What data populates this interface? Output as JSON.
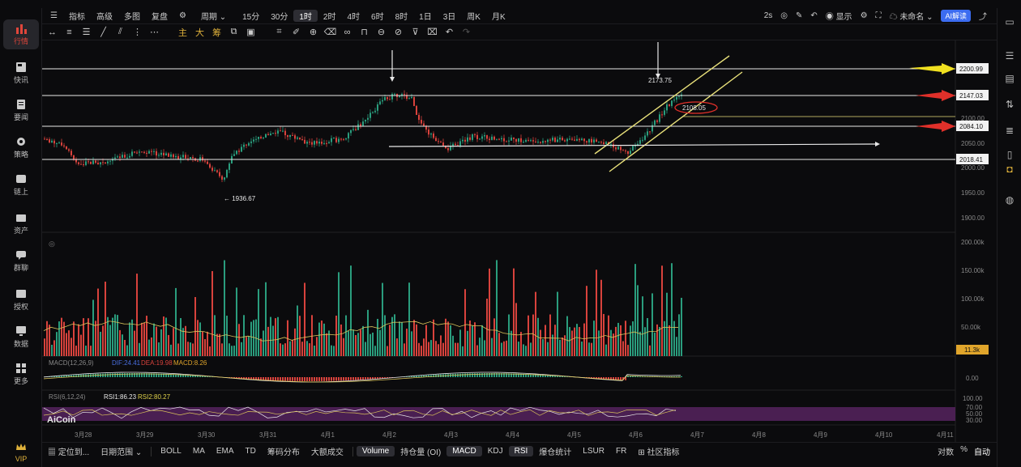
{
  "nav": {
    "items": [
      {
        "label": "行情",
        "icon": "bar-chart-icon"
      },
      {
        "label": "快讯",
        "icon": "news-icon"
      },
      {
        "label": "要闻",
        "icon": "document-icon"
      },
      {
        "label": "策略",
        "icon": "strategy-icon"
      },
      {
        "label": "链上",
        "icon": "chain-icon"
      },
      {
        "label": "资产",
        "icon": "wallet-icon"
      },
      {
        "label": "群聊",
        "icon": "chat-icon"
      },
      {
        "label": "授权",
        "icon": "key-icon"
      },
      {
        "label": "数据",
        "icon": "monitor-icon"
      },
      {
        "label": "更多",
        "icon": "grid-icon"
      },
      {
        "label": "VIP",
        "icon": "crown-icon"
      }
    ]
  },
  "toolbar": {
    "items": [
      "指标",
      "高级",
      "多图",
      "复盘"
    ],
    "period_label": "周期",
    "periods": [
      "15分",
      "30分",
      "1时",
      "2时",
      "4时",
      "6时",
      "8时",
      "1日",
      "3日",
      "周K",
      "月K"
    ],
    "active_period": "1时",
    "right": {
      "refresh": "2s",
      "display": "显示",
      "unnamed": "未命名",
      "ai": "AI解读"
    }
  },
  "drawtools": {
    "labels": [
      "主",
      "大",
      "筹"
    ]
  },
  "chart": {
    "price_labels": [
      "2200.99",
      "2147.03",
      "2084.10",
      "2018.41"
    ],
    "price_axis": [
      "2150.00",
      "2100.00",
      "2050.00",
      "2000.00",
      "1950.00",
      "1900.00"
    ],
    "annotations": {
      "high": "2173.75",
      "circle": "2108.05",
      "low": "← 1936.67"
    },
    "volume_axis": [
      "200.00k",
      "150.00k",
      "100.00k",
      "50.00k"
    ],
    "volume_current": "11.3k",
    "macd": {
      "label": "MACD(12,26,9)",
      "dif": "DIF:24.41",
      "dea": "DEA:19.98",
      "macd": "MACD:8.26",
      "axis": "0.00"
    },
    "rsi": {
      "label": "RSI(6,12,24)",
      "rsi1": "RSI1:86.23",
      "rsi2": "RSI2:80.27",
      "axis": [
        "100.00",
        "70.00",
        "50.00",
        "30.00"
      ]
    },
    "dates": [
      "3月28",
      "3月29",
      "3月30",
      "3月31",
      "4月1",
      "4月2",
      "4月3",
      "4月4",
      "4月5",
      "4月6",
      "4月7",
      "4月8",
      "4月9",
      "4月10",
      "4月11"
    ],
    "logo": "AiCoin",
    "colors": {
      "up": "#2a9d7d",
      "down": "#d8423c",
      "hline": "#e8e8e8",
      "channel": "#e8e07a",
      "arrow_red": "#e0302a",
      "arrow_yellow": "#f0e020",
      "rsi_band": "#4a1f52",
      "vol_label_bg": "#e0a52b"
    }
  },
  "bottombar": {
    "left": [
      "定位到...",
      "日期范围"
    ],
    "indicators": [
      "BOLL",
      "MA",
      "EMA",
      "TD",
      "筹码分布",
      "大额成交",
      "Volume",
      "持仓量 (OI)",
      "MACD",
      "KDJ",
      "RSI",
      "爆仓统计",
      "LSUR",
      "FR",
      "社区指标"
    ],
    "active": [
      "Volume",
      "MACD",
      "RSI"
    ],
    "right": [
      "对数",
      "%",
      "自动"
    ]
  }
}
